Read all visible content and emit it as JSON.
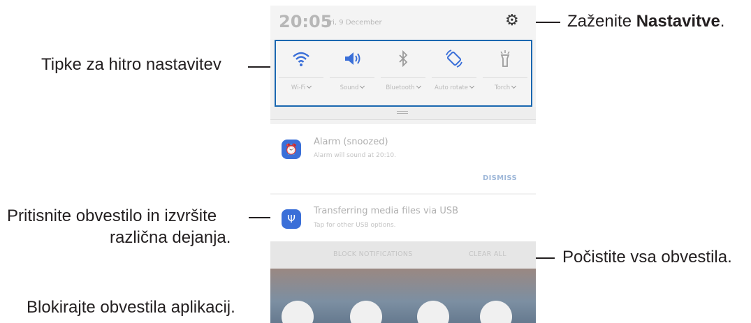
{
  "phone": {
    "time": "20:05",
    "date": "Fri, 9 December",
    "quick_settings": [
      {
        "label": "Wi-Fi",
        "icon": "wifi-icon"
      },
      {
        "label": "Sound",
        "icon": "speaker-icon"
      },
      {
        "label": "Bluetooth",
        "icon": "bluetooth-icon"
      },
      {
        "label": "Auto rotate",
        "icon": "auto-rotate-icon"
      },
      {
        "label": "Torch",
        "icon": "torch-icon"
      }
    ],
    "notifications": [
      {
        "title": "Alarm (snoozed)",
        "text": "Alarm will sound at 20:10.",
        "action": "DISMISS",
        "icon": "alarm-icon"
      },
      {
        "title": "Transferring media files via USB",
        "text": "Tap for other USB options.",
        "icon": "usb-icon"
      }
    ],
    "block_label": "BLOCK NOTIFICATIONS",
    "clear_label": "CLEAR ALL"
  },
  "callouts": {
    "settings_prefix": "Zaženite ",
    "settings_bold": "Nastavitve",
    "settings_suffix": ".",
    "quick_settings": "Tipke za hitro nastavitev",
    "notification_line1": "Pritisnite obvestilo in izvršite",
    "notification_line2": "različna dejanja.",
    "clear_all": "Počistite vsa obvestila.",
    "block": "Blokirajte obvestila aplikacij."
  },
  "colors": {
    "highlight": "#1a67b0",
    "icon_blue": "#3a6fd8",
    "dismiss": "#9fb8d9"
  }
}
